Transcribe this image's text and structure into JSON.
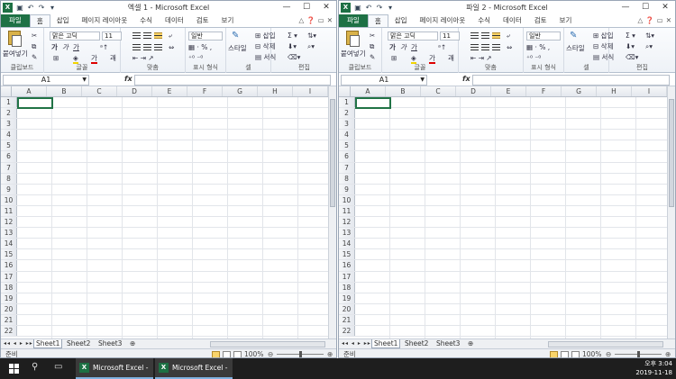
{
  "windows": [
    {
      "title": "엑셀 1 - Microsoft Excel",
      "tabs": [
        "파일",
        "홈",
        "삽입",
        "페이지 레이아웃",
        "수식",
        "데이터",
        "검토",
        "보기"
      ],
      "ribbon": {
        "paste": "붙여넣기",
        "font_name": "맑은 고딕",
        "font_size": "11",
        "number_format": "일반",
        "style": "스타일",
        "insert": "삽입",
        "delete": "삭제",
        "format": "서식",
        "groups": [
          "클립보드",
          "글꼴",
          "맞춤",
          "표시 형식",
          "셀",
          "편집"
        ]
      },
      "name_box": "A1",
      "fx": "fx",
      "columns": [
        "A",
        "B",
        "C",
        "D",
        "E",
        "F",
        "G",
        "H",
        "I"
      ],
      "rows": [
        "1",
        "2",
        "3",
        "4",
        "5",
        "6",
        "7",
        "8",
        "9",
        "10",
        "11",
        "12",
        "13",
        "14",
        "15",
        "16",
        "17",
        "18",
        "19",
        "20",
        "21",
        "22"
      ],
      "sheets": [
        "Sheet1",
        "Sheet2",
        "Sheet3"
      ],
      "status": "준비",
      "zoom": "100%"
    },
    {
      "title": "파일 2 - Microsoft Excel",
      "tabs": [
        "파일",
        "홈",
        "삽입",
        "페이지 레이아웃",
        "수식",
        "데이터",
        "검토",
        "보기"
      ],
      "ribbon": {
        "paste": "붙여넣기",
        "font_name": "맑은 고딕",
        "font_size": "11",
        "number_format": "일반",
        "style": "스타일",
        "insert": "삽입",
        "delete": "삭제",
        "format": "서식",
        "groups": [
          "클립보드",
          "글꼴",
          "맞춤",
          "표시 형식",
          "셀",
          "편집"
        ]
      },
      "name_box": "A1",
      "fx": "fx",
      "columns": [
        "A",
        "B",
        "C",
        "D",
        "E",
        "F",
        "G",
        "H",
        "I"
      ],
      "rows": [
        "1",
        "2",
        "3",
        "4",
        "5",
        "6",
        "7",
        "8",
        "9",
        "10",
        "11",
        "12",
        "13",
        "14",
        "15",
        "16",
        "17",
        "18",
        "19",
        "20",
        "21",
        "22"
      ],
      "sheets": [
        "Sheet1",
        "Sheet2",
        "Sheet3"
      ],
      "status": "준비",
      "zoom": "100%"
    }
  ],
  "taskbar": {
    "apps": [
      "Microsoft Excel - ...",
      "Microsoft Excel - ..."
    ],
    "time": "오후 3:04",
    "date": "2019-11-18"
  },
  "colors": {
    "excel_green": "#1e7145",
    "taskbar": "#1e1e1e",
    "selection": "#217346"
  },
  "icons": [
    "excel-icon",
    "save-icon",
    "undo-icon",
    "redo-icon",
    "help-icon",
    "windows-start-icon",
    "search-icon",
    "task-view-icon"
  ]
}
